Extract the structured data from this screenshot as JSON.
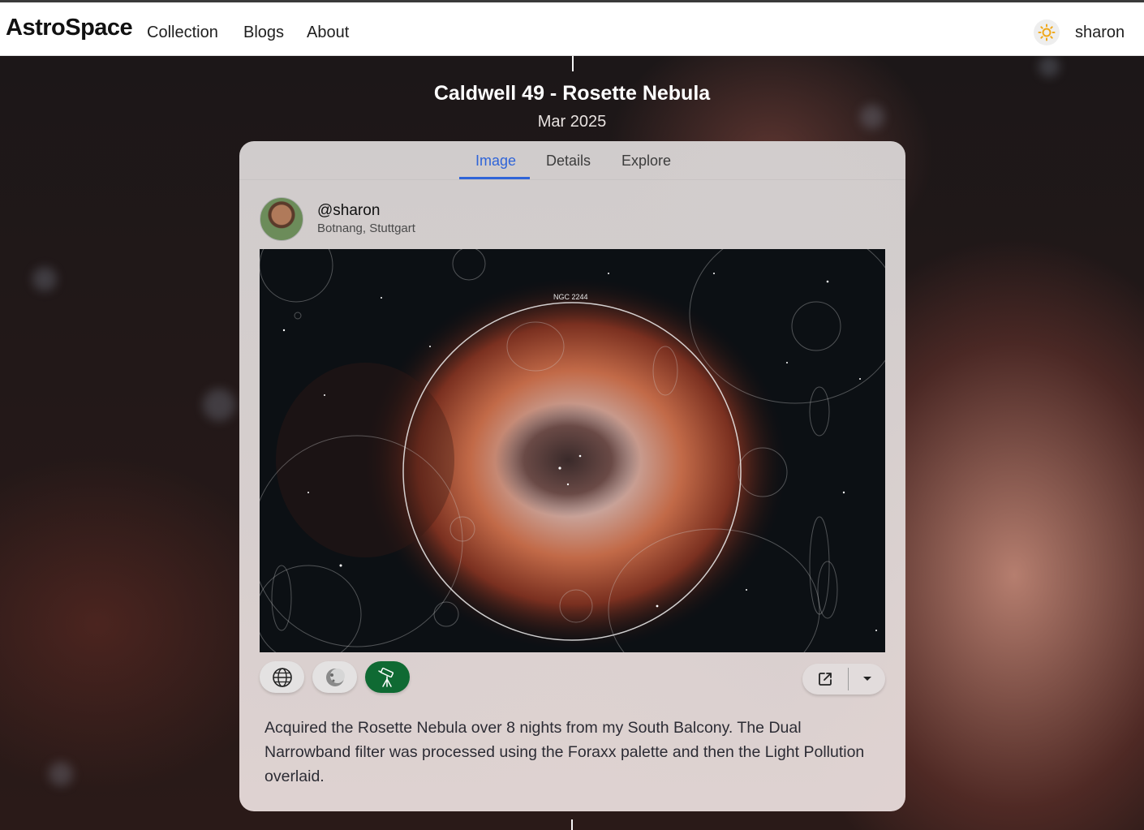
{
  "header": {
    "logo": "AstroSpace",
    "nav": [
      "Collection",
      "Blogs",
      "About"
    ],
    "theme_icon": "sun-icon",
    "user": "sharon"
  },
  "post": {
    "title": "Caldwell 49 - Rosette Nebula",
    "date": "Mar 2025",
    "tabs": [
      "Image",
      "Details",
      "Explore"
    ],
    "active_tab": "Image",
    "author": {
      "handle": "@sharon",
      "location": "Botnang, Stuttgart"
    },
    "image_annotation": "NGC 2244",
    "controls": [
      {
        "icon": "globe-icon",
        "active": false
      },
      {
        "icon": "moon-icon",
        "active": false
      },
      {
        "icon": "telescope-icon",
        "active": true
      }
    ],
    "share_icon": "external-link-icon",
    "dropdown_icon": "caret-down-icon",
    "description": "Acquired the Rosette Nebula over 8 nights from my South Balcony. The Dual Narrowband filter was processed using the Foraxx palette and then the Light Pollution overlaid."
  },
  "colors": {
    "accent": "#2f64d8",
    "telescope_active": "#0f6a33",
    "header_bg": "#ffffff"
  }
}
